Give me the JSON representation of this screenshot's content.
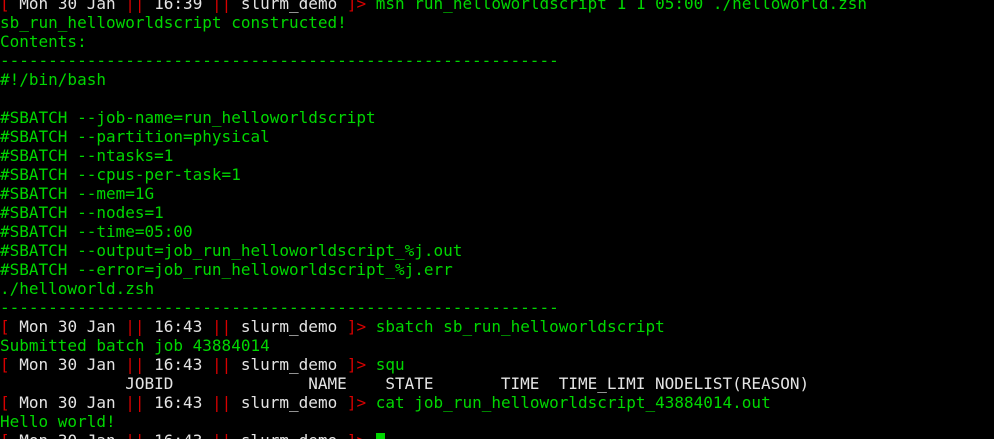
{
  "colors": {
    "background": "#000000",
    "output_green": "#00d700",
    "prompt_red": "#d70000",
    "prompt_white": "#e4e4e4"
  },
  "prompt": {
    "open_bracket": "[",
    "separator": "||",
    "close": "]>"
  },
  "lines": [
    {
      "kind": "prompt",
      "date": "Mon 30 Jan",
      "time": "16:39",
      "dir": "slurm_demo",
      "cmd": "msh run_helloworldscript 1 1 05:00 ./helloworld.zsh"
    },
    {
      "kind": "out",
      "color": "green",
      "text": "sb_run_helloworldscript constructed!"
    },
    {
      "kind": "out",
      "color": "green",
      "text": "Contents:"
    },
    {
      "kind": "out",
      "color": "green",
      "text": "----------------------------------------------------------"
    },
    {
      "kind": "out",
      "color": "green",
      "text": "#!/bin/bash"
    },
    {
      "kind": "out",
      "color": "green",
      "text": ""
    },
    {
      "kind": "out",
      "color": "green",
      "text": "#SBATCH --job-name=run_helloworldscript"
    },
    {
      "kind": "out",
      "color": "green",
      "text": "#SBATCH --partition=physical"
    },
    {
      "kind": "out",
      "color": "green",
      "text": "#SBATCH --ntasks=1"
    },
    {
      "kind": "out",
      "color": "green",
      "text": "#SBATCH --cpus-per-task=1"
    },
    {
      "kind": "out",
      "color": "green",
      "text": "#SBATCH --mem=1G"
    },
    {
      "kind": "out",
      "color": "green",
      "text": "#SBATCH --nodes=1"
    },
    {
      "kind": "out",
      "color": "green",
      "text": "#SBATCH --time=05:00"
    },
    {
      "kind": "out",
      "color": "green",
      "text": "#SBATCH --output=job_run_helloworldscript_%j.out"
    },
    {
      "kind": "out",
      "color": "green",
      "text": "#SBATCH --error=job_run_helloworldscript_%j.err"
    },
    {
      "kind": "out",
      "color": "green",
      "text": "./helloworld.zsh"
    },
    {
      "kind": "out",
      "color": "green",
      "text": "----------------------------------------------------------"
    },
    {
      "kind": "prompt",
      "date": "Mon 30 Jan",
      "time": "16:43",
      "dir": "slurm_demo",
      "cmd": "sbatch sb_run_helloworldscript"
    },
    {
      "kind": "out",
      "color": "green",
      "text": "Submitted batch job 43884014"
    },
    {
      "kind": "prompt",
      "date": "Mon 30 Jan",
      "time": "16:43",
      "dir": "slurm_demo",
      "cmd": "squ"
    },
    {
      "kind": "out",
      "color": "white",
      "text": "             JOBID              NAME    STATE       TIME  TIME_LIMI NODELIST(REASON)"
    },
    {
      "kind": "prompt",
      "date": "Mon 30 Jan",
      "time": "16:43",
      "dir": "slurm_demo",
      "cmd": "cat job_run_helloworldscript_43884014.out"
    },
    {
      "kind": "out",
      "color": "green",
      "text": "Hello world!"
    },
    {
      "kind": "prompt",
      "date": "Mon 30 Jan",
      "time": "16:43",
      "dir": "slurm_demo",
      "cmd": "",
      "cursor": true
    }
  ]
}
